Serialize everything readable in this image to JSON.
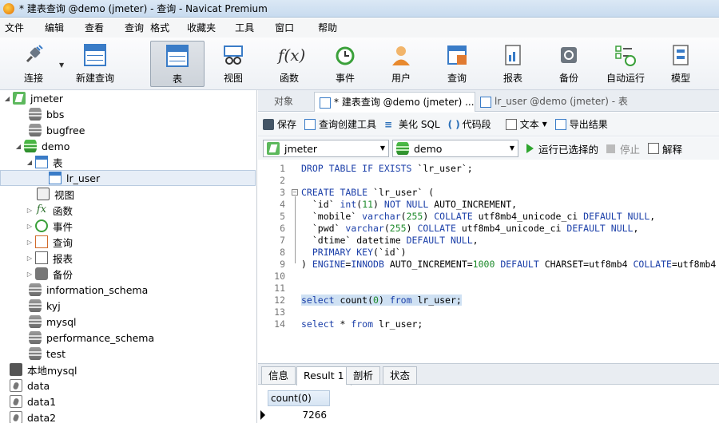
{
  "window": {
    "title": "* 建表查询 @demo (jmeter) - 查询 - Navicat Premium"
  },
  "menu": [
    "文件",
    "编辑",
    "查看",
    "查询",
    "格式",
    "收藏夹",
    "工具",
    "窗口",
    "帮助"
  ],
  "toolbar": {
    "buttons": [
      {
        "label": "连接",
        "icon": "plug-icon"
      },
      {
        "label": "新建查询",
        "icon": "new-query-icon"
      },
      {
        "label": "表",
        "icon": "table-icon",
        "active": true
      },
      {
        "label": "视图",
        "icon": "view-icon"
      },
      {
        "label": "函数",
        "icon": "function-icon"
      },
      {
        "label": "事件",
        "icon": "clock-icon"
      },
      {
        "label": "用户",
        "icon": "user-icon"
      },
      {
        "label": "查询",
        "icon": "query-icon"
      },
      {
        "label": "报表",
        "icon": "report-icon"
      },
      {
        "label": "备份",
        "icon": "backup-icon"
      },
      {
        "label": "自动运行",
        "icon": "autorun-icon"
      },
      {
        "label": "模型",
        "icon": "model-icon"
      }
    ]
  },
  "sidebar": {
    "connection": "jmeter",
    "databases_top": [
      "bbs",
      "bugfree"
    ],
    "demo": {
      "name": "demo",
      "tables_label": "表",
      "table": "lr_user",
      "views_label": "视图",
      "functions_label": "函数",
      "events_label": "事件",
      "queries_label": "查询",
      "reports_label": "报表",
      "backups_label": "备份"
    },
    "databases_bottom": [
      "information_schema",
      "kyj",
      "mysql",
      "performance_schema",
      "test"
    ],
    "other_connections": [
      "本地mysql",
      "data",
      "data1",
      "data2"
    ]
  },
  "tabs": [
    {
      "label": "对象"
    },
    {
      "label": "* 建表查询 @demo (jmeter) ..."
    },
    {
      "label": "lr_user @demo (jmeter) - 表"
    }
  ],
  "editbar": {
    "save": "保存",
    "query_builder": "查询创建工具",
    "beautify": "美化 SQL",
    "snippet": "代码段",
    "text": "文本",
    "export": "导出结果"
  },
  "selbar": {
    "connection": "jmeter",
    "database": "demo",
    "run": "运行已选择的",
    "stop": "停止",
    "explain": "解释"
  },
  "editor": {
    "line_numbers": [
      "1",
      "2",
      "3",
      "4",
      "5",
      "6",
      "7",
      "8",
      "9",
      "10",
      "11",
      "12",
      "13",
      "14"
    ]
  },
  "result_tabs": [
    "信息",
    "Result 1",
    "剖析",
    "状态"
  ],
  "result": {
    "column": "count(0)",
    "value": "7266"
  }
}
